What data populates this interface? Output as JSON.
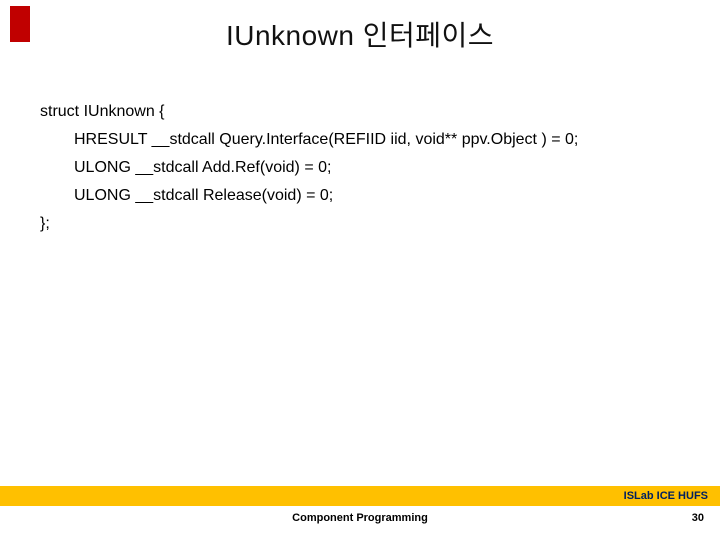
{
  "title": "IUnknown 인터페이스",
  "code": {
    "l1": "struct IUnknown {",
    "l2": "HRESULT __stdcall Query.Interface(REFIID iid, void** ppv.Object ) = 0;",
    "l3": "ULONG __stdcall Add.Ref(void) = 0;",
    "l4": "ULONG __stdcall Release(void) = 0;",
    "l5": "};"
  },
  "footer": {
    "lab": "ISLab ICE HUFS",
    "center": "Component Programming",
    "page": "30"
  }
}
